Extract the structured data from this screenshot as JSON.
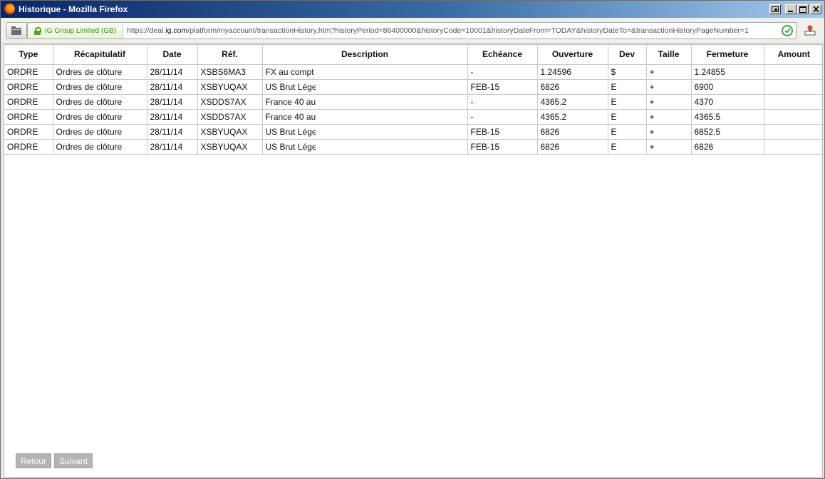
{
  "window": {
    "title": "Historique - Mozilla Firefox"
  },
  "navbar": {
    "site_identity": "IG Group Limited (GB)",
    "url_prefix": "https://deal.",
    "url_domain": "ig.com",
    "url_rest": "/platform/myaccount/transactionHistory.htm?historyPeriod=86400000&historyCode=10001&historyDateFrom=TODAY&historyDateTo=&transactionHistoryPageNumber=1"
  },
  "table": {
    "headers": [
      "Type",
      "Récapitulatif",
      "Date",
      "Réf.",
      "Description",
      "Echéance",
      "Ouverture",
      "Dev",
      "Taille",
      "Fermeture",
      "Amount"
    ],
    "rows": [
      [
        "ORDRE",
        "Ordres de clôture",
        "28/11/14",
        "XSBS6MA3",
        "FX au compt",
        "-",
        "1.24596",
        "$",
        "+",
        "1.24855",
        ""
      ],
      [
        "ORDRE",
        "Ordres de clôture",
        "28/11/14",
        "XSBYUQAX",
        "US Brut Lége",
        "FEB-15",
        "6826",
        "E",
        "+",
        "6900",
        ""
      ],
      [
        "ORDRE",
        "Ordres de clôture",
        "28/11/14",
        "XSDDS7AX",
        "France 40 au",
        "-",
        "4365.2",
        "E",
        "+",
        "4370",
        ""
      ],
      [
        "ORDRE",
        "Ordres de clôture",
        "28/11/14",
        "XSDDS7AX",
        "France 40 au",
        "-",
        "4365.2",
        "E",
        "+",
        "4365.5",
        ""
      ],
      [
        "ORDRE",
        "Ordres de clôture",
        "28/11/14",
        "XSBYUQAX",
        "US Brut Lége",
        "FEB-15",
        "6826",
        "E",
        "+",
        "6852.5",
        ""
      ],
      [
        "ORDRE",
        "Ordres de clôture",
        "28/11/14",
        "XSBYUQAX",
        "US Brut Lége",
        "FEB-15",
        "6826",
        "E",
        "+",
        "6826",
        ""
      ]
    ]
  },
  "pager": {
    "prev_label": "Retour",
    "next_label": "Suivant"
  }
}
